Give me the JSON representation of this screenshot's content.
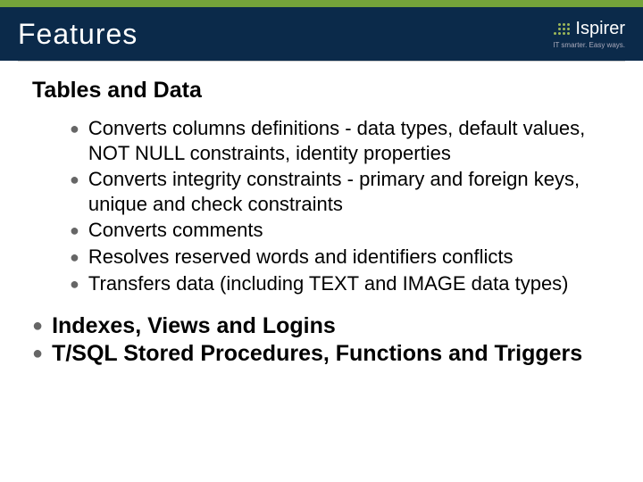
{
  "header": {
    "title": "Features",
    "logo": "Ispirer",
    "tagline": "IT smarter. Easy ways."
  },
  "body": {
    "section_heading": "Tables and Data",
    "sub_bullets": [
      "Converts columns definitions - data types, default values, NOT NULL constraints, identity properties",
      "Converts integrity constraints - primary and foreign keys, unique and check constraints",
      "Converts comments",
      "Resolves reserved words and identifiers conflicts",
      "Transfers data (including TEXT and IMAGE data types)"
    ],
    "main_bullets": [
      "Indexes, Views and Logins",
      "T/SQL Stored Procedures, Functions and Triggers"
    ]
  }
}
